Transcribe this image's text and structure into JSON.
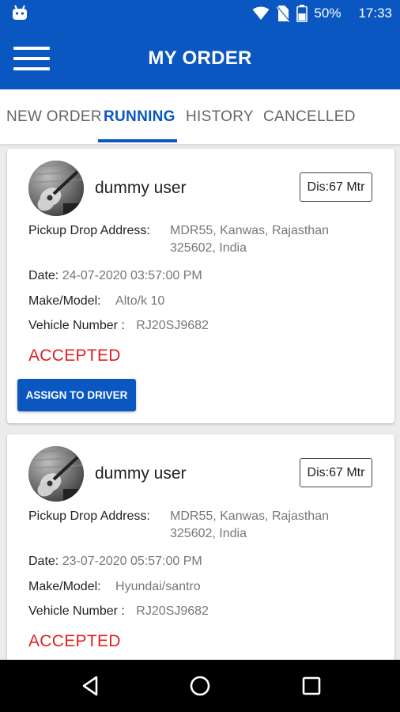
{
  "status_bar": {
    "battery": "50%",
    "time": "17:33"
  },
  "app_bar": {
    "title": "MY ORDER"
  },
  "tabs": [
    {
      "label": "NEW ORDER",
      "active": false
    },
    {
      "label": "RUNNING",
      "active": true
    },
    {
      "label": "HISTORY",
      "active": false
    },
    {
      "label": "CANCELLED",
      "active": false
    }
  ],
  "orders": [
    {
      "user_name": "dummy user",
      "distance": "Dis:67 Mtr",
      "address_label": "Pickup Drop Address:",
      "address_line1": "MDR55, Kanwas, Rajasthan",
      "address_line2": "325602, India",
      "date_label": "Date:",
      "date_value": "24-07-2020 03:57:00 PM",
      "make_label": "Make/Model:",
      "make_value": "Alto/k 10",
      "vehicle_label": "Vehicle Number :",
      "vehicle_value": "RJ20SJ9682",
      "status": "ACCEPTED",
      "button_label": "ASSIGN TO DRIVER"
    },
    {
      "user_name": "dummy user",
      "distance": "Dis:67 Mtr",
      "address_label": "Pickup Drop Address:",
      "address_line1": "MDR55, Kanwas, Rajasthan",
      "address_line2": "325602, India",
      "date_label": "Date:",
      "date_value": "23-07-2020 05:57:00 PM",
      "make_label": "Make/Model:",
      "make_value": "Hyundai/santro",
      "vehicle_label": "Vehicle Number :",
      "vehicle_value": "RJ20SJ9682",
      "status": "ACCEPTED"
    }
  ],
  "colors": {
    "primary": "#0a57c2",
    "status_accepted": "#e02020"
  },
  "icons": {
    "nav_back": "back-triangle-icon",
    "nav_home": "home-circle-icon",
    "nav_recents": "recents-square-icon"
  }
}
